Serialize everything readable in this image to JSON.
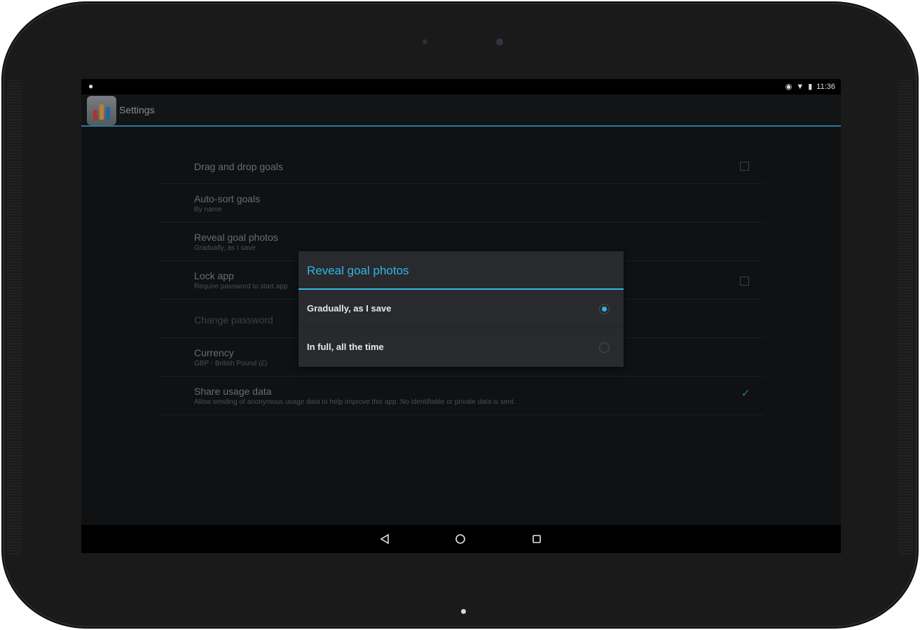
{
  "status_bar": {
    "time": "11:36",
    "notification_icon": "notification-icon",
    "icons": [
      "sync-icon",
      "wifi-icon",
      "battery-icon"
    ]
  },
  "action_bar": {
    "title": "Settings",
    "app_icon": "app-icon"
  },
  "settings": [
    {
      "title": "Drag and drop goals",
      "summary": "",
      "control": "checkbox",
      "checked": false
    },
    {
      "title": "Auto-sort goals",
      "summary": "By name",
      "control": "none"
    },
    {
      "title": "Reveal goal photos",
      "summary": "Gradually, as I save",
      "control": "none"
    },
    {
      "title": "Lock app",
      "summary": "Require password to start app",
      "control": "checkbox",
      "checked": false
    },
    {
      "title": "Change password",
      "summary": "",
      "control": "none",
      "disabled": true
    },
    {
      "title": "Currency",
      "summary": "GBP - British Pound (£)",
      "control": "none"
    },
    {
      "title": "Share usage data",
      "summary": "Allow sending of anonymous usage data to help improve this app. No identifiable or private data is sent.",
      "control": "checkmark",
      "checked": true
    }
  ],
  "dialog": {
    "title": "Reveal goal photos",
    "options": [
      {
        "label": "Gradually, as I save",
        "selected": true
      },
      {
        "label": "In full, all the time",
        "selected": false
      }
    ]
  },
  "nav_bar": {
    "buttons": [
      "back-icon",
      "home-icon",
      "recents-icon"
    ]
  },
  "colors": {
    "accent": "#33b5e5",
    "screen_bg": "#0f1112",
    "dialog_bg": "#282a2d"
  }
}
